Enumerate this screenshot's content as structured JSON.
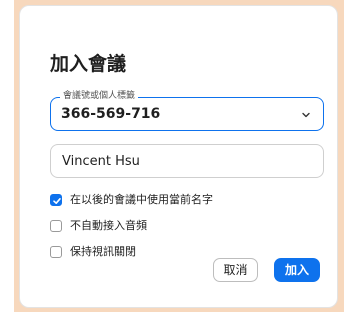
{
  "dialog": {
    "title": "加入會議",
    "meeting_id_field": {
      "label": "會議號或個人標籤",
      "value": "366-569-716",
      "icon": "chevron-down-icon"
    },
    "name_field": {
      "value": "Vincent Hsu"
    },
    "options": [
      {
        "label": "在以後的會議中使用當前名字",
        "checked": true
      },
      {
        "label": "不自動接入音頻",
        "checked": false
      },
      {
        "label": "保持視訊關閉",
        "checked": false
      }
    ],
    "buttons": {
      "cancel": "取消",
      "join": "加入"
    }
  },
  "colors": {
    "accent": "#0e72ed",
    "frame_background": "#f7d8bd"
  }
}
